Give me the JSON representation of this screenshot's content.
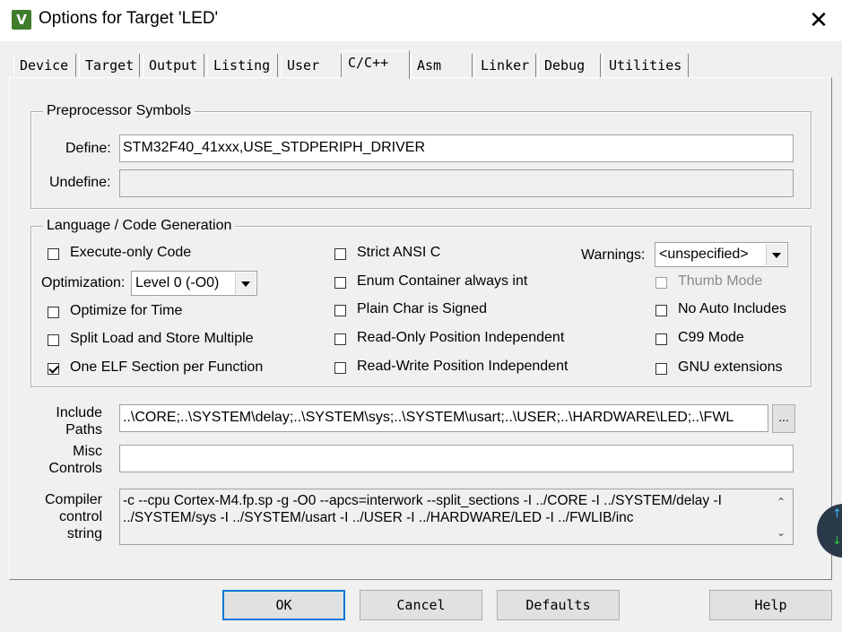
{
  "window": {
    "title": "Options for Target 'LED'",
    "icon": "keil-uv-icon"
  },
  "tabs": [
    {
      "label": "Device"
    },
    {
      "label": "Target"
    },
    {
      "label": "Output"
    },
    {
      "label": "Listing"
    },
    {
      "label": "User"
    },
    {
      "label": "C/C++",
      "active": true
    },
    {
      "label": "Asm"
    },
    {
      "label": "Linker"
    },
    {
      "label": "Debug"
    },
    {
      "label": "Utilities"
    }
  ],
  "preprocessor": {
    "legend": "Preprocessor Symbols",
    "define_label": "Define:",
    "define_value": "STM32F40_41xxx,USE_STDPERIPH_DRIVER",
    "undefine_label": "Undefine:",
    "undefine_value": ""
  },
  "codegen": {
    "legend": "Language / Code Generation",
    "execute_only": {
      "label": "Execute-only Code",
      "checked": false
    },
    "optimization_label": "Optimization:",
    "optimization_value": "Level 0 (-O0)",
    "optimize_time": {
      "label": "Optimize for Time",
      "checked": false
    },
    "split_load": {
      "label": "Split Load and Store Multiple",
      "checked": false
    },
    "one_elf": {
      "label": "One ELF Section per Function",
      "checked": true
    },
    "strict_ansi": {
      "label": "Strict ANSI C",
      "checked": false
    },
    "enum_container": {
      "label": "Enum Container always int",
      "checked": false
    },
    "plain_char": {
      "label": "Plain Char is Signed",
      "checked": false
    },
    "ro_pi": {
      "label": "Read-Only Position Independent",
      "checked": false
    },
    "rw_pi": {
      "label": "Read-Write Position Independent",
      "checked": false
    },
    "warnings_label": "Warnings:",
    "warnings_value": "<unspecified>",
    "thumb_mode": {
      "label": "Thumb Mode",
      "checked": false,
      "disabled": true
    },
    "no_auto_includes": {
      "label": "No Auto Includes",
      "checked": false
    },
    "c99_mode": {
      "label": "C99 Mode",
      "checked": false
    },
    "gnu_ext": {
      "label": "GNU extensions",
      "checked": false
    }
  },
  "include_paths": {
    "label_line1": "Include",
    "label_line2": "Paths",
    "value": "..\\CORE;..\\SYSTEM\\delay;..\\SYSTEM\\sys;..\\SYSTEM\\usart;..\\USER;..\\HARDWARE\\LED;..\\FWL",
    "browse_label": "..."
  },
  "misc_controls": {
    "label_line1": "Misc",
    "label_line2": "Controls",
    "value": ""
  },
  "compiler_string": {
    "label_line1": "Compiler",
    "label_line2": "control",
    "label_line3": "string",
    "line1": "-c --cpu Cortex-M4.fp.sp -g -O0 --apcs=interwork --split_sections -I ../CORE -I ../SYSTEM/delay -I",
    "line2": "../SYSTEM/sys -I ../SYSTEM/usart -I ../USER -I ../HARDWARE/LED -I ../FWLIB/inc"
  },
  "buttons": {
    "ok": "OK",
    "cancel": "Cancel",
    "defaults": "Defaults",
    "help": "Help"
  },
  "colors": {
    "default_button_border": "#0078d7",
    "dialog_bg": "#f0f0f0"
  }
}
